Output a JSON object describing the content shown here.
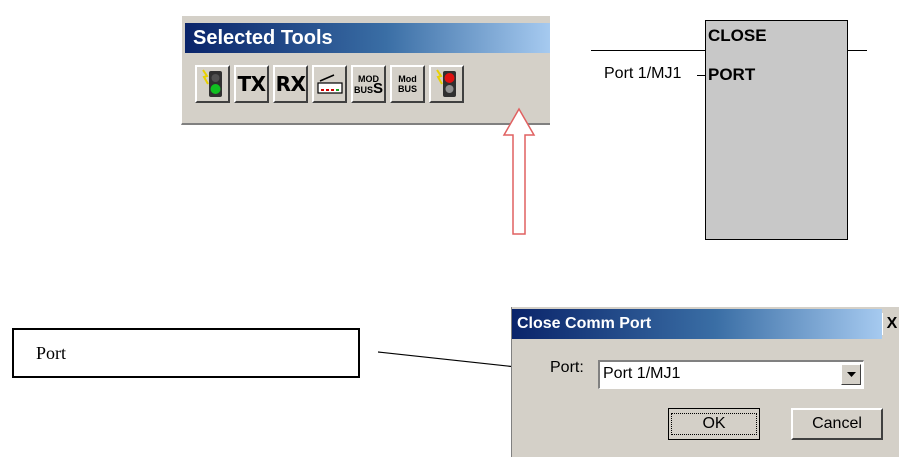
{
  "toolbar": {
    "title": "Selected Tools",
    "tools": [
      {
        "id": "open-port",
        "icon": "traffic-light-green-icon"
      },
      {
        "id": "tx",
        "label": "TX"
      },
      {
        "id": "rx",
        "label": "RX"
      },
      {
        "id": "modem",
        "icon": "modem-icon"
      },
      {
        "id": "modbus-slave",
        "label_top": "MOD",
        "label_bot": "BUS",
        "label_suffix": "S"
      },
      {
        "id": "modbus-master",
        "label_top": "Mod",
        "label_bot": "BUS"
      },
      {
        "id": "close-port",
        "icon": "traffic-light-red-icon"
      }
    ]
  },
  "function_block": {
    "title": "CLOSE",
    "input_name": "PORT",
    "input_connection": "Port 1/MJ1"
  },
  "callout": {
    "label": "Port"
  },
  "dialog": {
    "title": "Close Comm Port",
    "close_glyph": "X",
    "port_label": "Port:",
    "port_value": "Port 1/MJ1",
    "ok_label": "OK",
    "cancel_label": "Cancel"
  },
  "colors": {
    "titlebar_start": "#0a246a",
    "titlebar_end": "#a6caf0",
    "face": "#d4d0c8",
    "block_fill": "#c8c8c8",
    "arrow": "#e06060"
  }
}
